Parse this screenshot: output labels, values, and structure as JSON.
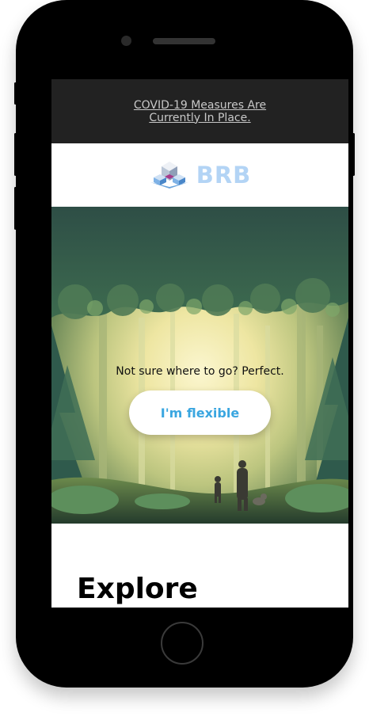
{
  "notice": {
    "text": "COVID-19 Measures Are Currently In Place."
  },
  "header": {
    "logo_text": "BRB",
    "logo_icon": "cube-stack-icon"
  },
  "hero": {
    "prompt": "Not sure where to go? Perfect.",
    "button_label": "I'm flexible",
    "image": "forest-illustration"
  },
  "main": {
    "section_title": "Explore"
  },
  "colors": {
    "notice_bg": "#222222",
    "logo": "#b3d4f5",
    "button_text": "#3aa6e0",
    "device": "#000000"
  }
}
